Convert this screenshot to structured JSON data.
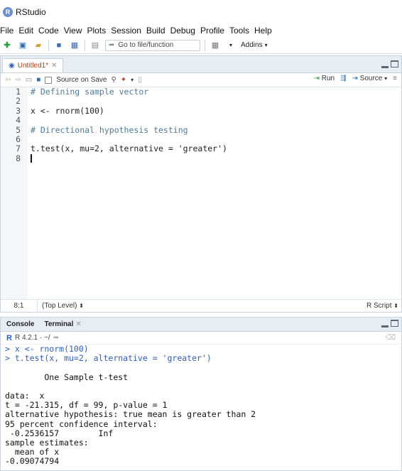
{
  "window": {
    "title": "RStudio",
    "logo_letter": "R"
  },
  "menu": [
    "File",
    "Edit",
    "Code",
    "View",
    "Plots",
    "Session",
    "Build",
    "Debug",
    "Profile",
    "Tools",
    "Help"
  ],
  "toolbar": {
    "goto_placeholder": "Go to file/function",
    "addins_label": "Addins"
  },
  "editor": {
    "tab_label": "Untitled1*",
    "source_on_save": "Source on Save",
    "run_label": "Run",
    "source_label": "Source",
    "lines": [
      {
        "n": "1",
        "text": "# Defining sample vector"
      },
      {
        "n": "2",
        "text": ""
      },
      {
        "n": "3",
        "text": "x <- rnorm(100)"
      },
      {
        "n": "4",
        "text": ""
      },
      {
        "n": "5",
        "text": "# Directional hypothesis testing"
      },
      {
        "n": "6",
        "text": ""
      },
      {
        "n": "7",
        "text": "t.test(x, mu=2, alternative = 'greater')"
      },
      {
        "n": "8",
        "text": ""
      }
    ],
    "status": {
      "position": "8:1",
      "scope": "(Top Level)",
      "file_type": "R Script"
    }
  },
  "console": {
    "tabs": [
      "Console",
      "Terminal"
    ],
    "r_version": "R 4.2.1 · ~/",
    "output": [
      "> x <- rnorm(100)",
      "> t.test(x, mu=2, alternative = 'greater')",
      "",
      "        One Sample t-test",
      "",
      "data:  x",
      "t = -21.315, df = 99, p-value = 1",
      "alternative hypothesis: true mean is greater than 2",
      "95 percent confidence interval:",
      " -0.2536157        Inf",
      "sample estimates:",
      "  mean of x",
      "-0.09074794"
    ]
  }
}
